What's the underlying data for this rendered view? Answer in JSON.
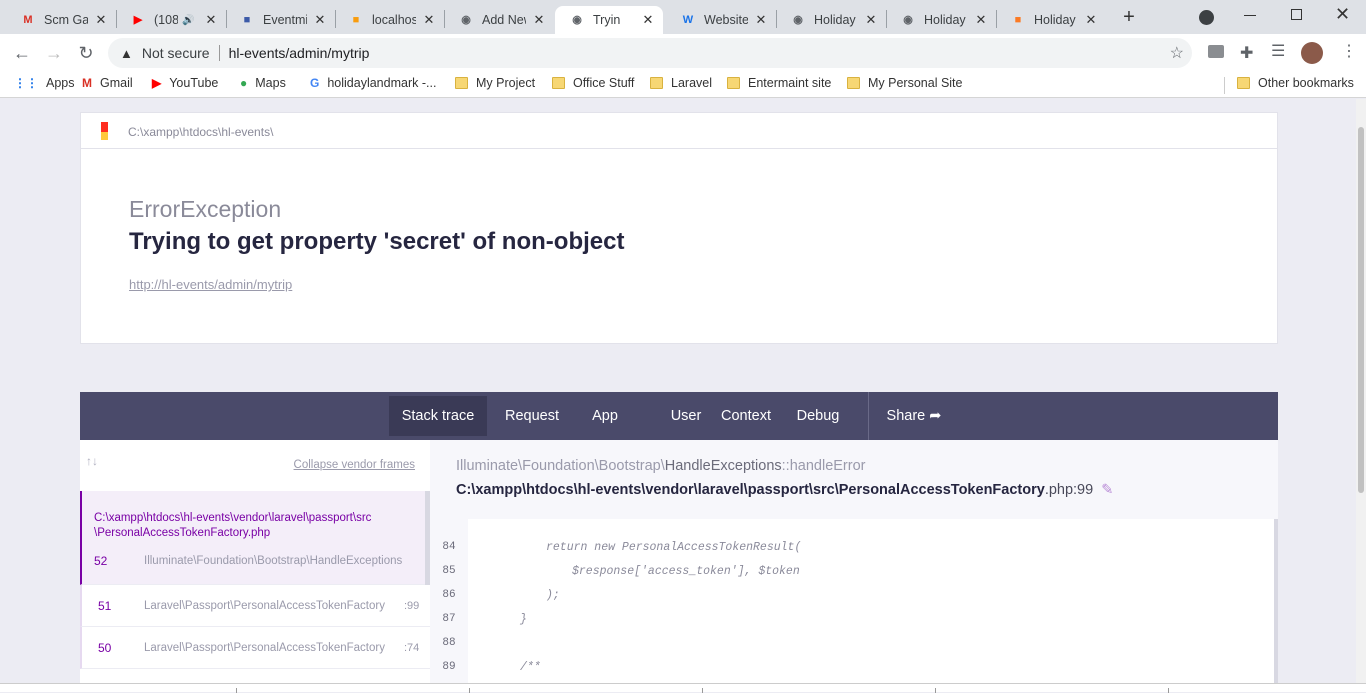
{
  "browser": {
    "tabs": [
      {
        "title": "Scm Gal",
        "icon": "gmail-icon",
        "color": "#d93025"
      },
      {
        "title": "(108",
        "icon": "youtube-icon",
        "color": "#ff0000",
        "audio": true
      },
      {
        "title": "Eventmi",
        "icon": "calendar-icon",
        "color": "#3c5aa8"
      },
      {
        "title": "localhost",
        "icon": "phpmyadmin-icon",
        "color": "#f89c0e"
      },
      {
        "title": "Add New",
        "icon": "globe-icon",
        "color": "#5f6368"
      },
      {
        "title": "Tryin",
        "icon": "globe-icon",
        "color": "#5f6368",
        "active": true
      },
      {
        "title": "Websites",
        "icon": "w-icon",
        "color": "#1a73e8"
      },
      {
        "title": "Holiday",
        "icon": "globe-icon",
        "color": "#5f6368"
      },
      {
        "title": "Holiday",
        "icon": "globe-icon",
        "color": "#5f6368"
      },
      {
        "title": "Holiday",
        "icon": "xampp-icon",
        "color": "#fb7a24"
      }
    ],
    "new_tab": "+",
    "security_label": "Not secure",
    "url": "hl-events/admin/mytrip",
    "bookmarks": [
      {
        "label": "Apps",
        "type": "apps"
      },
      {
        "label": "Gmail",
        "type": "gmail"
      },
      {
        "label": "YouTube",
        "type": "youtube"
      },
      {
        "label": "Maps",
        "type": "maps"
      },
      {
        "label": "holidaylandmark -...",
        "type": "google"
      },
      {
        "label": "My Project",
        "type": "folder"
      },
      {
        "label": "Office Stuff",
        "type": "folder"
      },
      {
        "label": "Laravel",
        "type": "folder"
      },
      {
        "label": "Entermaint site",
        "type": "folder"
      },
      {
        "label": "My Personal Site",
        "type": "folder"
      }
    ],
    "other_bookmarks": "Other bookmarks"
  },
  "ignition": {
    "path": "C:\\xampp\\htdocs\\hl-events\\",
    "exception_class": "ErrorException",
    "message": "Trying to get property 'secret' of non-object",
    "request_url": "http://hl-events/admin/mytrip",
    "tabs": [
      "Stack trace",
      "Request",
      "App",
      "User",
      "Context",
      "Debug",
      "Share"
    ],
    "active_tab": "Stack trace",
    "collapse_vendor": "Collapse vendor frames",
    "frames": [
      {
        "number": "52",
        "file": "C:\\xampp\\htdocs\\hl-events\\vendor\\laravel\\passport\\src\\PersonalAccessTokenFactory.php",
        "class": "Illuminate\\Foundation\\Bootstrap\\HandleExceptions",
        "line": ""
      },
      {
        "number": "51",
        "class": "Laravel\\Passport\\PersonalAccessTokenFactory",
        "line": ":99"
      },
      {
        "number": "50",
        "class": "Laravel\\Passport\\PersonalAccessTokenFactory",
        "line": ":74"
      }
    ],
    "selected": {
      "namespace": "Illuminate\\Foundation\\Bootstrap\\",
      "class": "HandleExceptions",
      "method": "::handleError",
      "file": "C:\\xampp\\htdocs\\hl-events\\vendor\\laravel\\passport\\src\\PersonalAccessTokenFactory",
      "ext_line": ".php:99"
    },
    "code": [
      {
        "n": "84",
        "text": "return new PersonalAccessTokenResult(",
        "indent": 3
      },
      {
        "n": "85",
        "text": "$response['access_token'], $token",
        "indent": 4
      },
      {
        "n": "86",
        "text": ");",
        "indent": 3
      },
      {
        "n": "87",
        "text": "}",
        "indent": 2
      },
      {
        "n": "88",
        "text": "",
        "indent": 0
      },
      {
        "n": "89",
        "text": "/**",
        "indent": 2
      }
    ]
  },
  "colors": {
    "accent": "#7900a5",
    "nav_bg": "#4a4a6a",
    "active_tab_bg": "#3a3a56"
  }
}
